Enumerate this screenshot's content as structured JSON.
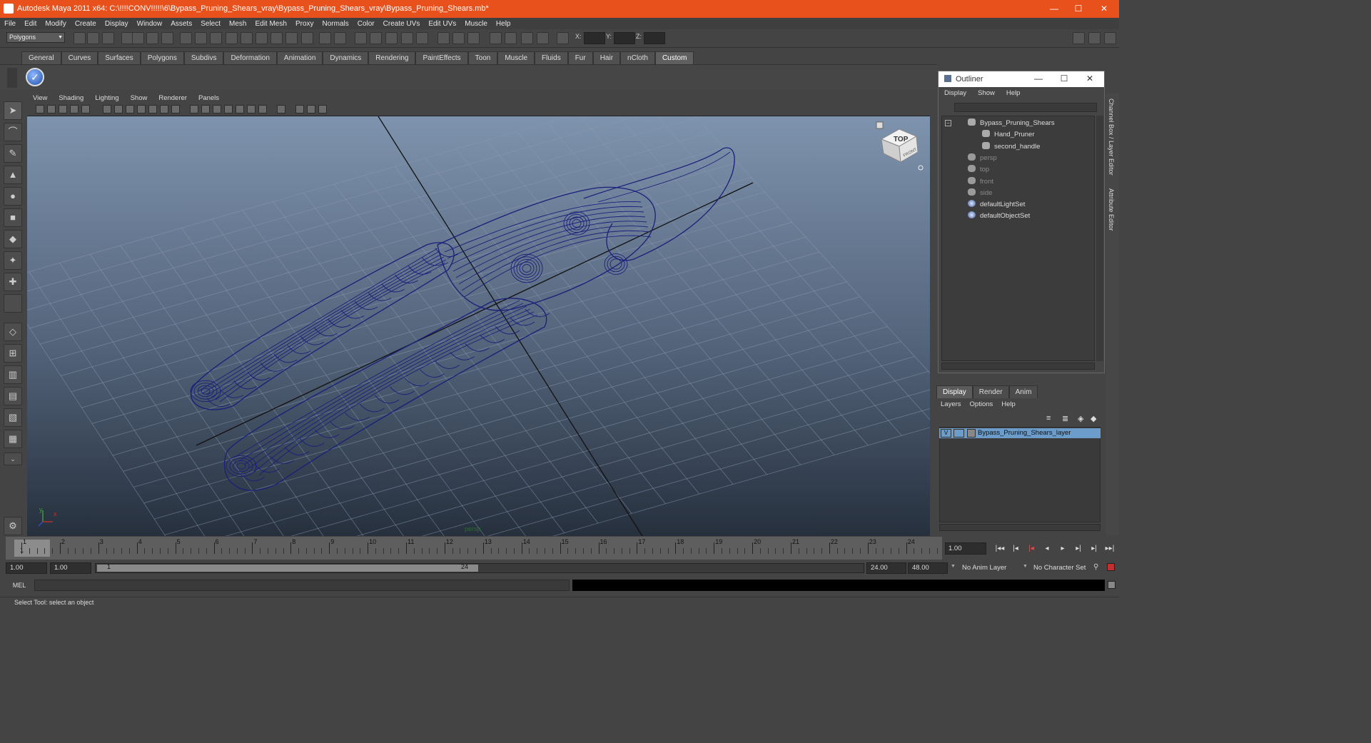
{
  "window": {
    "title": "Autodesk Maya 2011 x64: C:\\!!!!CONV!!!!!\\6\\Bypass_Pruning_Shears_vray\\Bypass_Pruning_Shears_vray\\Bypass_Pruning_Shears.mb*",
    "minimize": "—",
    "maximize": "☐",
    "close": "✕"
  },
  "menubar": [
    "File",
    "Edit",
    "Modify",
    "Create",
    "Display",
    "Window",
    "Assets",
    "Select",
    "Mesh",
    "Edit Mesh",
    "Proxy",
    "Normals",
    "Color",
    "Create UVs",
    "Edit UVs",
    "Muscle",
    "Help"
  ],
  "statusline": {
    "mode": "Polygons",
    "x_label": "X:",
    "y_label": "Y:",
    "z_label": "Z:"
  },
  "shelf_tabs": [
    "General",
    "Curves",
    "Surfaces",
    "Polygons",
    "Subdivs",
    "Deformation",
    "Animation",
    "Dynamics",
    "Rendering",
    "PaintEffects",
    "Toon",
    "Muscle",
    "Fluids",
    "Fur",
    "Hair",
    "nCloth",
    "Custom"
  ],
  "shelf_active": "Custom",
  "panel_menu": [
    "View",
    "Shading",
    "Lighting",
    "Show",
    "Renderer",
    "Panels"
  ],
  "viewport": {
    "camera_label": "persp",
    "viewcube_top": "TOP",
    "viewcube_front": "FRONT",
    "axis_y": "y",
    "axis_x": "x",
    "bg_top": "#7e93ad",
    "bg_bottom": "#26303d",
    "wire_color": "#1a1f7a"
  },
  "outliner": {
    "title": "Outliner",
    "menu": [
      "Display",
      "Show",
      "Help"
    ],
    "items": [
      {
        "label": "Bypass_Pruning_Shears",
        "indent": 0,
        "dim": false,
        "icon": "mesh-group-icon"
      },
      {
        "label": "Hand_Pruner",
        "indent": 1,
        "dim": false,
        "icon": "mesh-icon"
      },
      {
        "label": "second_handle",
        "indent": 1,
        "dim": false,
        "icon": "mesh-icon"
      },
      {
        "label": "persp",
        "indent": 0,
        "dim": true,
        "icon": "camera-icon"
      },
      {
        "label": "top",
        "indent": 0,
        "dim": true,
        "icon": "camera-icon"
      },
      {
        "label": "front",
        "indent": 0,
        "dim": true,
        "icon": "camera-icon"
      },
      {
        "label": "side",
        "indent": 0,
        "dim": true,
        "icon": "camera-icon"
      },
      {
        "label": "defaultLightSet",
        "indent": 0,
        "dim": false,
        "icon": "set-icon"
      },
      {
        "label": "defaultObjectSet",
        "indent": 0,
        "dim": false,
        "icon": "set-icon"
      }
    ]
  },
  "layer_editor": {
    "tabs": [
      "Display",
      "Render",
      "Anim"
    ],
    "active_tab": "Display",
    "menu": [
      "Layers",
      "Options",
      "Help"
    ],
    "layer_name": "Bypass_Pruning_Shears_layer",
    "layer_visible": "V",
    "layer_color": "#6c9cc9"
  },
  "side_tabs": {
    "channel_box": "Channel Box / Layer Editor",
    "attribute_editor": "Attribute Editor"
  },
  "timeslider": {
    "ticks": [
      "1",
      "2",
      "3",
      "4",
      "5",
      "6",
      "7",
      "8",
      "9",
      "10",
      "11",
      "12",
      "13",
      "14",
      "15",
      "16",
      "17",
      "18",
      "19",
      "20",
      "21",
      "22",
      "23",
      "24"
    ],
    "current_frame": "1"
  },
  "playback": {
    "current_time": "1.00"
  },
  "range": {
    "start_time": "1.00",
    "playback_start": "1.00",
    "range_start_label": "1",
    "range_end_label": "24",
    "playback_end": "24.00",
    "end_time": "48.00",
    "anim_layer": "No Anim Layer",
    "character_set": "No Character Set"
  },
  "command_line": {
    "label": "MEL"
  },
  "help_line": "Select Tool: select an object"
}
